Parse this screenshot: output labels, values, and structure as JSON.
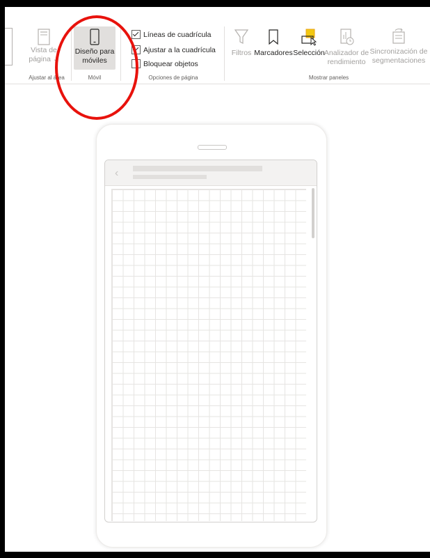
{
  "ribbon": {
    "groups": {
      "ajustar_area": "Ajustar al área",
      "movil": "Móvil",
      "opciones_pagina": "Opciones de página",
      "mostrar_paneles": "Mostrar paneles"
    },
    "vista_pagina": {
      "line1": "Vista de",
      "line2": "página ⌄"
    },
    "diseno_moviles": {
      "line1": "Diseño para",
      "line2": "móviles"
    },
    "checks": {
      "lineas": "Líneas de cuadrícula",
      "ajustar": "Ajustar a la cuadrícula",
      "bloquear": "Bloquear objetos"
    },
    "filtros": "Filtros",
    "marcadores": "Marcadores",
    "seleccion": "Selección",
    "analizador": {
      "line1": "Analizador de",
      "line2": "rendimiento"
    },
    "sincronizacion": {
      "line1": "Sincronización de",
      "line2": "segmentaciones"
    }
  },
  "colors": {
    "accent": "#f2c811",
    "annotation": "#e8120c"
  }
}
